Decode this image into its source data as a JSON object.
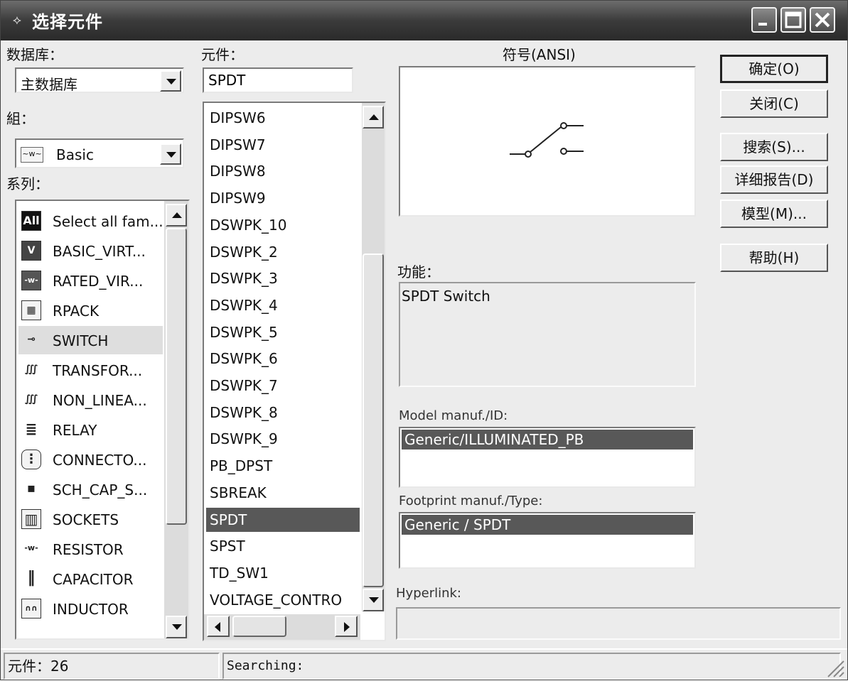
{
  "window": {
    "title": "选择元件",
    "controls": {
      "minimize": "minimize-icon",
      "maximize": "maximize-icon",
      "close": "close-icon"
    }
  },
  "database": {
    "label": "数据库：",
    "selected": "主数据库"
  },
  "group": {
    "label": "組：",
    "selected": "Basic"
  },
  "family": {
    "label": "系列：",
    "items": [
      {
        "label": "Select all fam...",
        "icon": "All"
      },
      {
        "label": "BASIC_VIRT...",
        "icon": "V"
      },
      {
        "label": "RATED_VIR...",
        "icon": "-w-"
      },
      {
        "label": "RPACK",
        "icon": "▦"
      },
      {
        "label": "SWITCH",
        "icon": "⊸"
      },
      {
        "label": "TRANSFOR...",
        "icon": "∭"
      },
      {
        "label": "NON_LINEA...",
        "icon": "∭"
      },
      {
        "label": "RELAY",
        "icon": "≣"
      },
      {
        "label": "CONNECTO...",
        "icon": "⋮"
      },
      {
        "label": "SCH_CAP_S...",
        "icon": "▪"
      },
      {
        "label": "SOCKETS",
        "icon": "▥"
      },
      {
        "label": "RESISTOR",
        "icon": "-w-"
      },
      {
        "label": "CAPACITOR",
        "icon": "‖"
      },
      {
        "label": "INDUCTOR",
        "icon": "∩∩"
      }
    ],
    "selected_index": 4
  },
  "component": {
    "label": "元件：",
    "value": "SPDT",
    "items": [
      "DIPSW6",
      "DIPSW7",
      "DIPSW8",
      "DIPSW9",
      "DSWPK_10",
      "DSWPK_2",
      "DSWPK_3",
      "DSWPK_4",
      "DSWPK_5",
      "DSWPK_6",
      "DSWPK_7",
      "DSWPK_8",
      "DSWPK_9",
      "PB_DPST",
      "SBREAK",
      "SPDT",
      "SPST",
      "TD_SW1",
      "VOLTAGE_CONTRO"
    ],
    "selected_index": 15
  },
  "symbol": {
    "label": "符号(ANSI)"
  },
  "function": {
    "label": "功能：",
    "value": "SPDT Switch"
  },
  "model": {
    "label": "Model manuf./ID:",
    "items": [
      "Generic/ILLUMINATED_PB"
    ]
  },
  "footprint": {
    "label": "Footprint manuf./Type:",
    "items": [
      "Generic / SPDT"
    ]
  },
  "hyperlink": {
    "label": "Hyperlink:",
    "value": ""
  },
  "buttons": {
    "ok": "确定(O)",
    "close": "关闭(C)",
    "search": "搜索(S)...",
    "detail": "详细报告(D)",
    "model": "模型(M)...",
    "help": "帮助(H)"
  },
  "status": {
    "count": "元件：26",
    "searching": "Searching:"
  }
}
